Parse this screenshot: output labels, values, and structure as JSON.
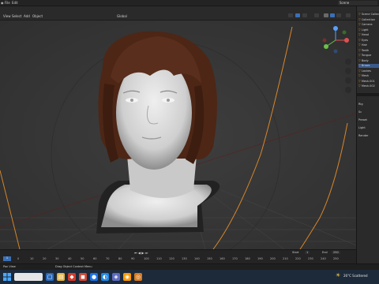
{
  "topbar": {
    "menus": [
      "File",
      "Edit",
      "Render",
      "Window",
      "Help"
    ],
    "workspaces": [
      "Layout",
      "Modeling",
      "Sculpting",
      "UV Editing",
      "Texture Paint",
      "Shading",
      "Animation",
      "Rendering",
      "Compositing",
      "Geometry Nodes",
      "Scripting"
    ],
    "active_workspace": "Layout",
    "scene_label": "Scene"
  },
  "header": {
    "mode": "Object Mode",
    "menus": [
      "View",
      "Select",
      "Add",
      "Object"
    ],
    "transform": "Global",
    "options": "Options"
  },
  "outliner": {
    "title": "Scene Collection",
    "rows": [
      "Scene Collection",
      "Collection",
      "Camera",
      "Light",
      "Head",
      "Eyes",
      "Hair",
      "Teeth",
      "Tongue",
      "Body",
      "Brows",
      "Lashes",
      "Mesh",
      "Mesh.001",
      "Mesh.002"
    ],
    "selected_index": 10
  },
  "properties": {
    "items": [
      "Rig",
      "Sc",
      "Preset",
      "Light",
      "Render"
    ]
  },
  "timeline": {
    "ticks": [
      "0",
      "10",
      "20",
      "30",
      "40",
      "50",
      "60",
      "70",
      "80",
      "90",
      "100",
      "110",
      "120",
      "130",
      "140",
      "150",
      "160",
      "170",
      "180",
      "190",
      "200",
      "210",
      "220",
      "230",
      "240",
      "250"
    ],
    "current_frame": "1",
    "start_label": "Start",
    "start_value": "1",
    "end_label": "End",
    "end_value": "250"
  },
  "statusbar": {
    "left_text": "Pan View",
    "center_text": "Drag Object Context Menu"
  },
  "taskbar": {
    "weather": "26°C Scattered"
  },
  "colors": {
    "viewport_bg": "#3b3b3b",
    "accent": "#3b6fb6",
    "hair": "#5a2e1c",
    "light_path": "#d8862a"
  }
}
